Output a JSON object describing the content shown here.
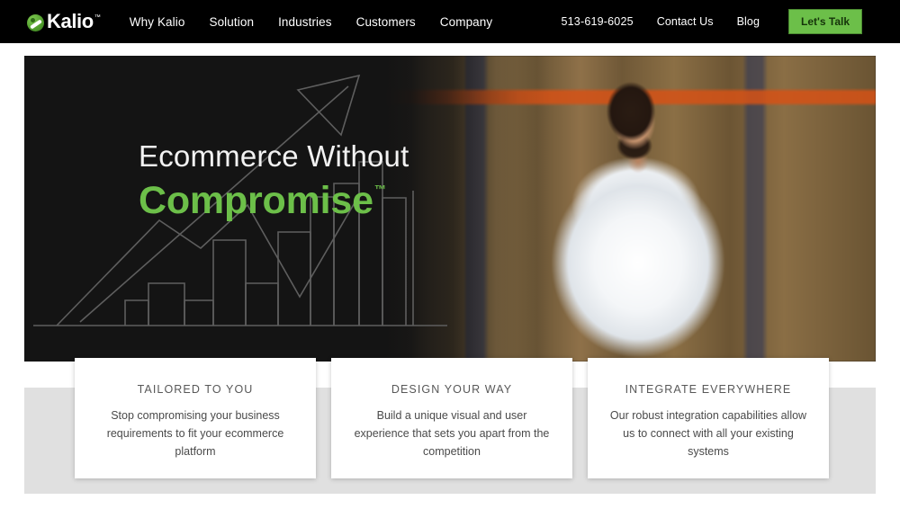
{
  "nav": {
    "brand": {
      "name": "Kalio",
      "trademark": "™",
      "logo_icon": "kalio-circle-swoosh-logo",
      "brand_color": "#4f9c2c"
    },
    "links": [
      {
        "label": "Why Kalio"
      },
      {
        "label": "Solution"
      },
      {
        "label": "Industries"
      },
      {
        "label": "Customers"
      },
      {
        "label": "Company"
      }
    ],
    "phone": "513-619-6025",
    "utility_links": [
      {
        "label": "Contact Us"
      },
      {
        "label": "Blog"
      }
    ],
    "cta": {
      "label": "Let's Talk",
      "background": "#6cbf49",
      "text_color": "#15330a"
    },
    "background": "#000000"
  },
  "hero": {
    "headline_line1": "Ecommerce Without",
    "headline_line2": "Compromise",
    "headline_trademark": "™",
    "accent_color": "#6cbf49",
    "background_color": "#141414",
    "artwork_icon": "rising-bar-chart-with-arrow-line-art",
    "photo_alt": "Smiling bearded man in white shirt with arms crossed in a warehouse"
  },
  "features": {
    "band_color": "#e0e0e0",
    "cards": [
      {
        "title": "TAILORED TO YOU",
        "body": "Stop compromising your business requirements to fit your ecommerce platform"
      },
      {
        "title": "DESIGN YOUR WAY",
        "body": "Build a unique visual and user experience that sets you apart from the competition"
      },
      {
        "title": "INTEGRATE EVERYWHERE",
        "body": "Our robust integration capabilities allow us to connect with all your existing systems"
      }
    ]
  }
}
